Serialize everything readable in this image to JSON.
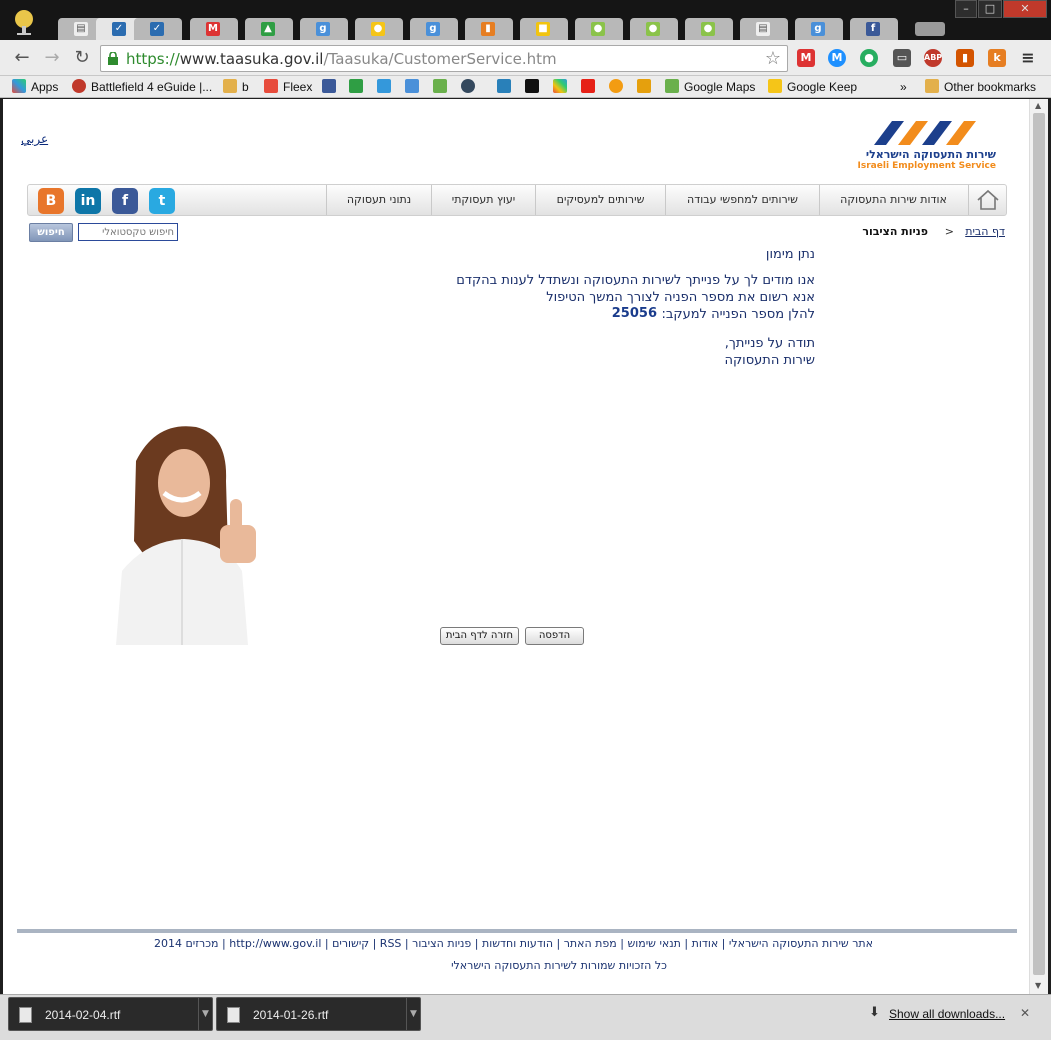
{
  "browser": {
    "url_scheme": "https://",
    "url_host": "www.taasuka.gov.il",
    "url_path": "/Taasuka/CustomerService.htm",
    "window_buttons": [
      "–",
      "□",
      "✕"
    ]
  },
  "bookmarks": [
    {
      "label": "Apps"
    },
    {
      "label": "Battlefield 4 eGuide |..."
    },
    {
      "label": "b"
    },
    {
      "label": "Fleex"
    },
    {
      "label": "Google Maps"
    },
    {
      "label": "Google Keep"
    },
    {
      "label": "»"
    },
    {
      "label": "Other bookmarks"
    }
  ],
  "page": {
    "arabic_link": "عربي",
    "logo_hebrew": "שירות התעסוקה הישראלי",
    "logo_english": "Israeli Employment Service",
    "nav": [
      {
        "label": "אודות שירות התעסוקה"
      },
      {
        "label": "שירותים למחפשי עבודה"
      },
      {
        "label": "שירותים למעסיקים"
      },
      {
        "label": "יעוץ תעסוקתי"
      },
      {
        "label": "נתוני תעסוקה"
      }
    ],
    "social": [
      "B",
      "in",
      "f",
      "t"
    ],
    "search_button": "חיפוש",
    "search_placeholder": "חיפוש טקסטואלי",
    "breadcrumb_home": "דף הבית",
    "breadcrumb_sep": ">",
    "breadcrumb_current": "פניות הציבור",
    "greeting": "נתן מימון",
    "line1": "אנו מודים לך על פנייתך לשירות התעסוקה ונשתדל לענות בהקדם",
    "line2": "אנא רשום את מספר הפניה לצורך המשך הטיפול",
    "line3": "להלן מספר הפנייה למעקב:",
    "ticket_number": "25056",
    "thanks": "תודה על פנייתך,",
    "signature": "שירות התעסוקה",
    "print_button": "הדפסה",
    "home_button": "חזרה לדף הבית",
    "footer_links": "אתר שירות התעסוקה הישראלי | אודות | תנאי שימוש | מפת האתר | הודעות וחדשות | פניות הציבור | RSS | קישורים | http://www.gov.il | מכרזים 2014",
    "footer_copyright": "כל הזכויות שמורות לשירות התעסוקה הישראלי"
  },
  "downloads": {
    "items": [
      {
        "name": "2014-02-04.rtf"
      },
      {
        "name": "2014-01-26.rtf"
      }
    ],
    "show_all": "Show all downloads...",
    "close": "✕"
  },
  "colors": {
    "brand_blue": "#1c3f8c",
    "brand_orange": "#f28c1c"
  }
}
